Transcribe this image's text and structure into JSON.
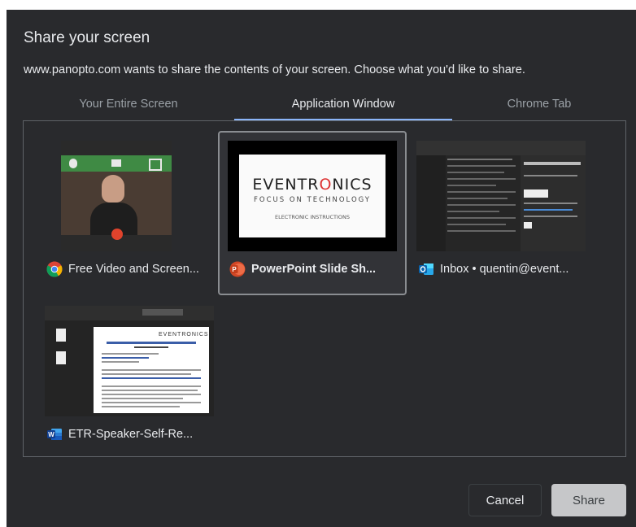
{
  "dialog": {
    "title": "Share your screen",
    "subtitle": "www.panopto.com wants to share the contents of your screen. Choose what you'd like to share."
  },
  "tabs": [
    {
      "label": "Your Entire Screen",
      "selected": false
    },
    {
      "label": "Application Window",
      "selected": true
    },
    {
      "label": "Chrome Tab",
      "selected": false
    }
  ],
  "windows": [
    {
      "label": "Free Video and Screen...",
      "icon": "chrome-icon",
      "selected": false
    },
    {
      "label": "PowerPoint Slide Sh...",
      "icon": "powerpoint-icon",
      "selected": true,
      "slide": {
        "brand_a": "EVENTR",
        "brand_o": "O",
        "brand_b": "NICS",
        "tagline": "FOCUS ON TECHNOLOGY",
        "line": "ELECTRONIC INSTRUCTIONS"
      }
    },
    {
      "label": "Inbox • quentin@event...",
      "icon": "outlook-icon",
      "selected": false
    },
    {
      "label": "ETR-Speaker-Self-Re...",
      "icon": "word-icon",
      "selected": false,
      "doc_header": "EVENTRONICS"
    }
  ],
  "buttons": {
    "cancel": "Cancel",
    "share": "Share"
  },
  "colors": {
    "dialog_bg": "#292a2d",
    "tab_active": "#8ab4f8",
    "recorder_green": "#3f8a44",
    "record_red": "#e0432c",
    "share_button_bg": "#c6c7c9"
  }
}
